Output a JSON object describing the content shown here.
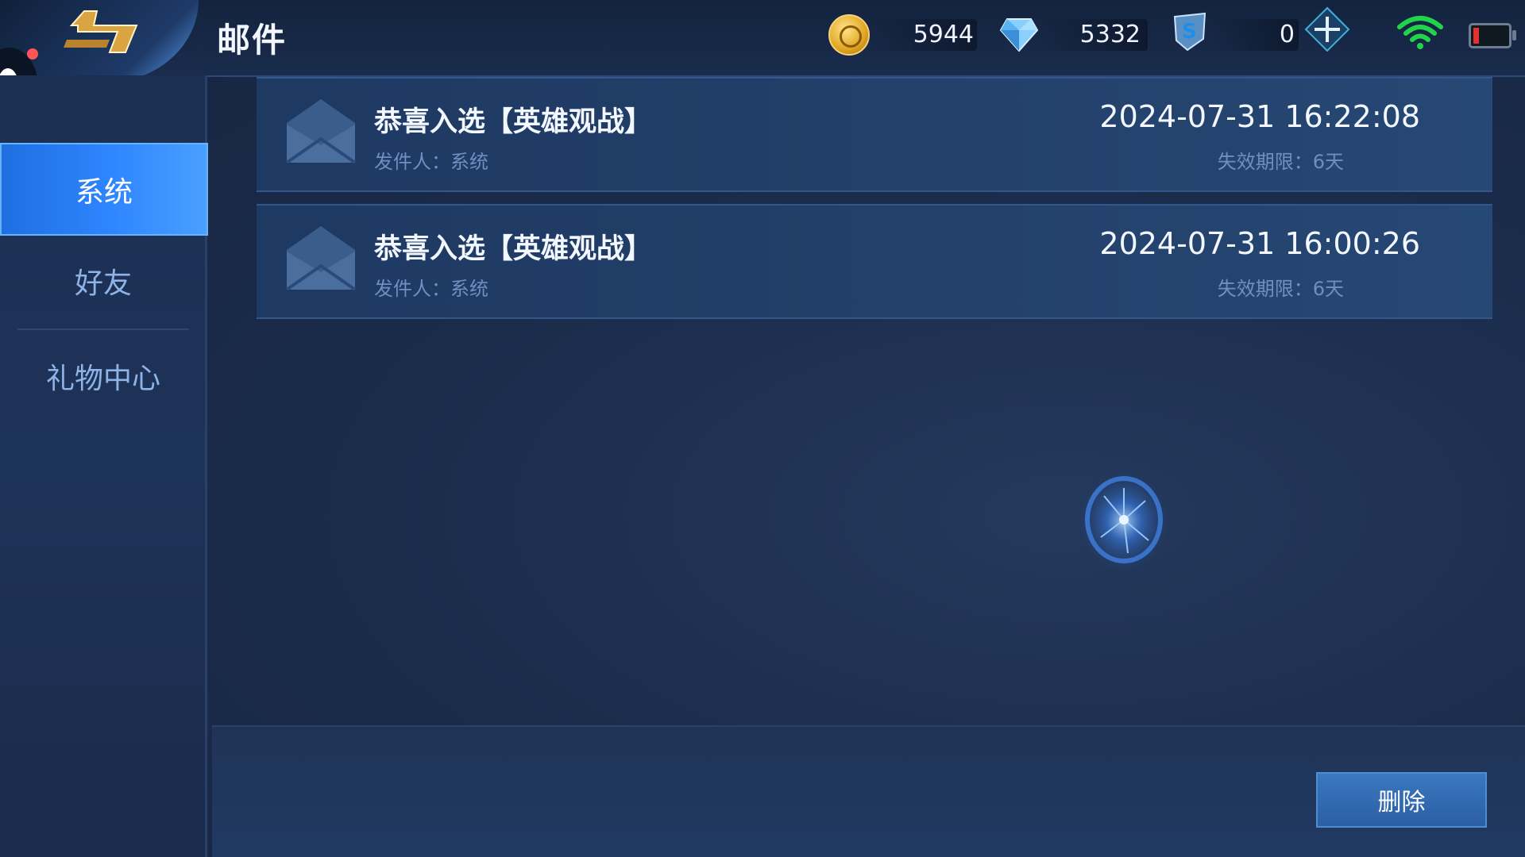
{
  "header": {
    "title": "邮件",
    "back_icon": "back-arrow-icon",
    "resources": [
      {
        "icon": "gold-coin-icon",
        "value": "5944"
      },
      {
        "icon": "diamond-icon",
        "value": "5332"
      },
      {
        "icon": "shield-token-icon",
        "value": "0"
      }
    ],
    "add_icon": "plus-icon",
    "status": {
      "wifi_icon": "wifi-icon",
      "battery_icon": "battery-icon",
      "battery_level": 0.1
    }
  },
  "sidebar": {
    "items": [
      {
        "label": "系统",
        "active": true
      },
      {
        "label": "好友",
        "active": false
      },
      {
        "label": "礼物中心",
        "active": false
      }
    ]
  },
  "mails": [
    {
      "subject": "恭喜入选【英雄观战】",
      "sender": "发件人：系统",
      "time": "2024-07-31 16:22:08",
      "expire": "失效期限：6天",
      "icon": "envelope-icon"
    },
    {
      "subject": "恭喜入选【英雄观战】",
      "sender": "发件人：系统",
      "time": "2024-07-31 16:00:26",
      "expire": "失效期限：6天",
      "icon": "envelope-icon"
    }
  ],
  "footer": {
    "delete_label": "删除"
  },
  "colors": {
    "accent": "#2f86ff",
    "background": "#1b2c4b",
    "text_muted": "#6f8fbf"
  }
}
